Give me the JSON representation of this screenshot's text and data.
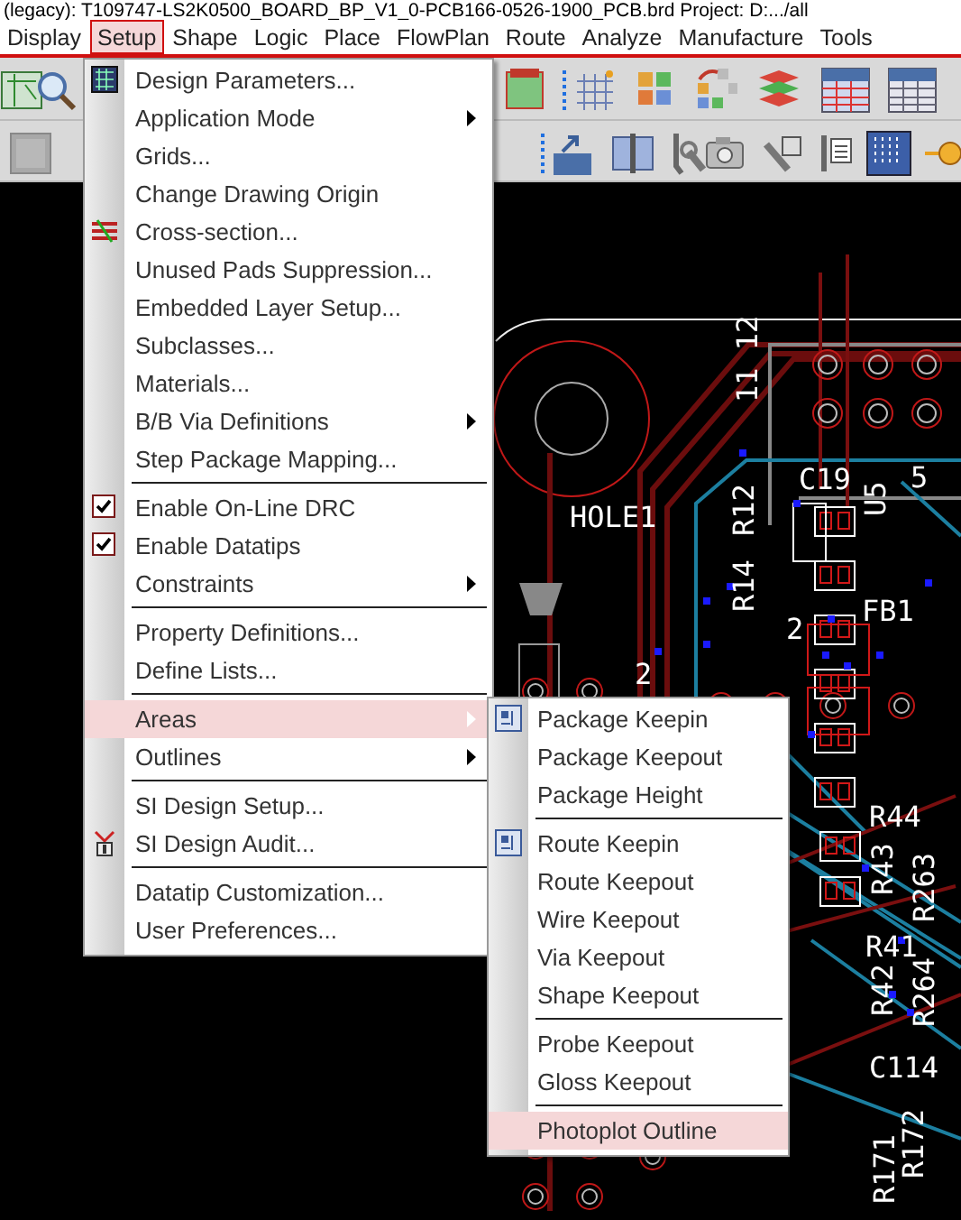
{
  "window": {
    "title": "(legacy): T109747-LS2K0500_BOARD_BP_V1_0-PCB166-0526-1900_PCB.brd  Project: D:.../all"
  },
  "menu_bar": [
    {
      "label": "Display",
      "selected": false
    },
    {
      "label": "Setup",
      "selected": true
    },
    {
      "label": "Shape",
      "selected": false
    },
    {
      "label": "Logic",
      "selected": false
    },
    {
      "label": "Place",
      "selected": false
    },
    {
      "label": "FlowPlan",
      "selected": false
    },
    {
      "label": "Route",
      "selected": false
    },
    {
      "label": "Analyze",
      "selected": false
    },
    {
      "label": "Manufacture",
      "selected": false
    },
    {
      "label": "Tools",
      "selected": false
    }
  ],
  "setup_menu": [
    [
      {
        "label": "Design Parameters...",
        "kind": "icon-command",
        "selected": false
      },
      {
        "label": "Application Mode",
        "kind": "submenu",
        "selected": false
      },
      {
        "label": "Grids...",
        "kind": "command",
        "selected": false
      },
      {
        "label": "Change Drawing Origin",
        "kind": "command",
        "selected": false
      },
      {
        "label": "Cross-section...",
        "kind": "icon-command",
        "selected": false
      },
      {
        "label": "Unused Pads Suppression...",
        "kind": "command",
        "selected": false
      },
      {
        "label": "Embedded Layer Setup...",
        "kind": "command",
        "selected": false
      },
      {
        "label": "Subclasses...",
        "kind": "command",
        "selected": false
      },
      {
        "label": "Materials...",
        "kind": "command",
        "selected": false
      },
      {
        "label": "B/B Via Definitions",
        "kind": "submenu",
        "selected": false
      },
      {
        "label": "Step Package Mapping...",
        "kind": "command",
        "selected": false
      }
    ],
    [
      {
        "label": "Enable On-Line DRC",
        "kind": "toggle",
        "checked": true,
        "selected": false
      },
      {
        "label": "Enable Datatips",
        "kind": "toggle",
        "checked": true,
        "selected": false
      },
      {
        "label": "Constraints",
        "kind": "submenu",
        "selected": false
      }
    ],
    [
      {
        "label": "Property Definitions...",
        "kind": "command",
        "selected": false
      },
      {
        "label": "Define Lists...",
        "kind": "command",
        "selected": false
      }
    ],
    [
      {
        "label": "Areas",
        "kind": "submenu",
        "selected": true
      },
      {
        "label": "Outlines",
        "kind": "submenu",
        "selected": false
      }
    ],
    [
      {
        "label": "SI Design Setup...",
        "kind": "command",
        "selected": false
      },
      {
        "label": "SI Design Audit...",
        "kind": "icon-command",
        "selected": false
      }
    ],
    [
      {
        "label": "Datatip Customization...",
        "kind": "command",
        "selected": false
      },
      {
        "label": "User Preferences...",
        "kind": "command",
        "selected": false
      }
    ]
  ],
  "areas_submenu": [
    [
      {
        "label": "Package Keepin",
        "kind": "icon-command",
        "selected": false
      },
      {
        "label": "Package Keepout",
        "kind": "command",
        "selected": false
      },
      {
        "label": "Package Height",
        "kind": "command",
        "selected": false
      }
    ],
    [
      {
        "label": "Route Keepin",
        "kind": "icon-command",
        "selected": false
      },
      {
        "label": "Route Keepout",
        "kind": "command",
        "selected": false
      },
      {
        "label": "Wire Keepout",
        "kind": "command",
        "selected": false
      },
      {
        "label": "Via Keepout",
        "kind": "command",
        "selected": false
      },
      {
        "label": "Shape Keepout",
        "kind": "command",
        "selected": false
      }
    ],
    [
      {
        "label": "Probe Keepout",
        "kind": "command",
        "selected": false
      },
      {
        "label": "Gloss Keepout",
        "kind": "command",
        "selected": false
      }
    ],
    [
      {
        "label": "Photoplot Outline",
        "kind": "command",
        "selected": true
      }
    ]
  ],
  "board_labels": [
    "HOLE1",
    "11 12",
    "R14",
    "R12",
    "C19",
    "U5",
    "5",
    "FB1",
    "2",
    "2",
    "R44",
    "R43",
    "R263",
    "R41",
    "R42",
    "R264",
    "C114",
    "R172",
    "R171"
  ]
}
